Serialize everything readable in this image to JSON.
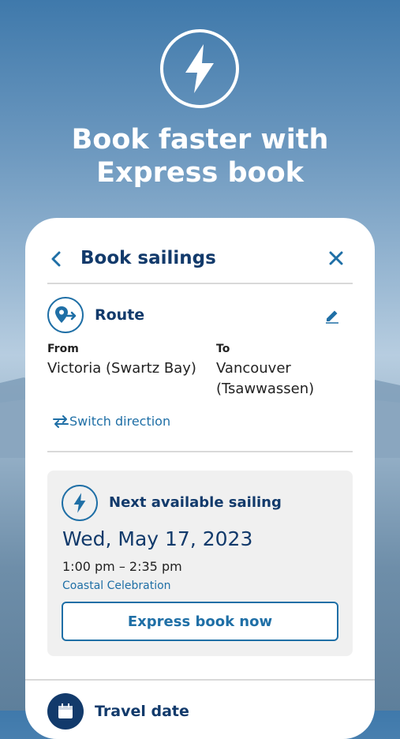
{
  "hero": {
    "line1": "Book faster with",
    "line2": "Express book",
    "icon": "lightning-bolt-icon"
  },
  "card": {
    "title": "Book sailings",
    "route": {
      "label": "Route",
      "from_label": "From",
      "from_value": "Victoria (Swartz Bay)",
      "to_label": "To",
      "to_value": "Vancouver (Tsawwassen)",
      "switch_label": "Switch direction"
    },
    "next": {
      "label": "Next available sailing",
      "date": "Wed, May 17, 2023",
      "times": "1:00 pm  –  2:35 pm",
      "vessel": "Coastal Celebration",
      "button": "Express book now"
    },
    "travel_label": "Travel date"
  },
  "colors": {
    "navy": "#123a6b",
    "accent": "#1f6fa6"
  }
}
